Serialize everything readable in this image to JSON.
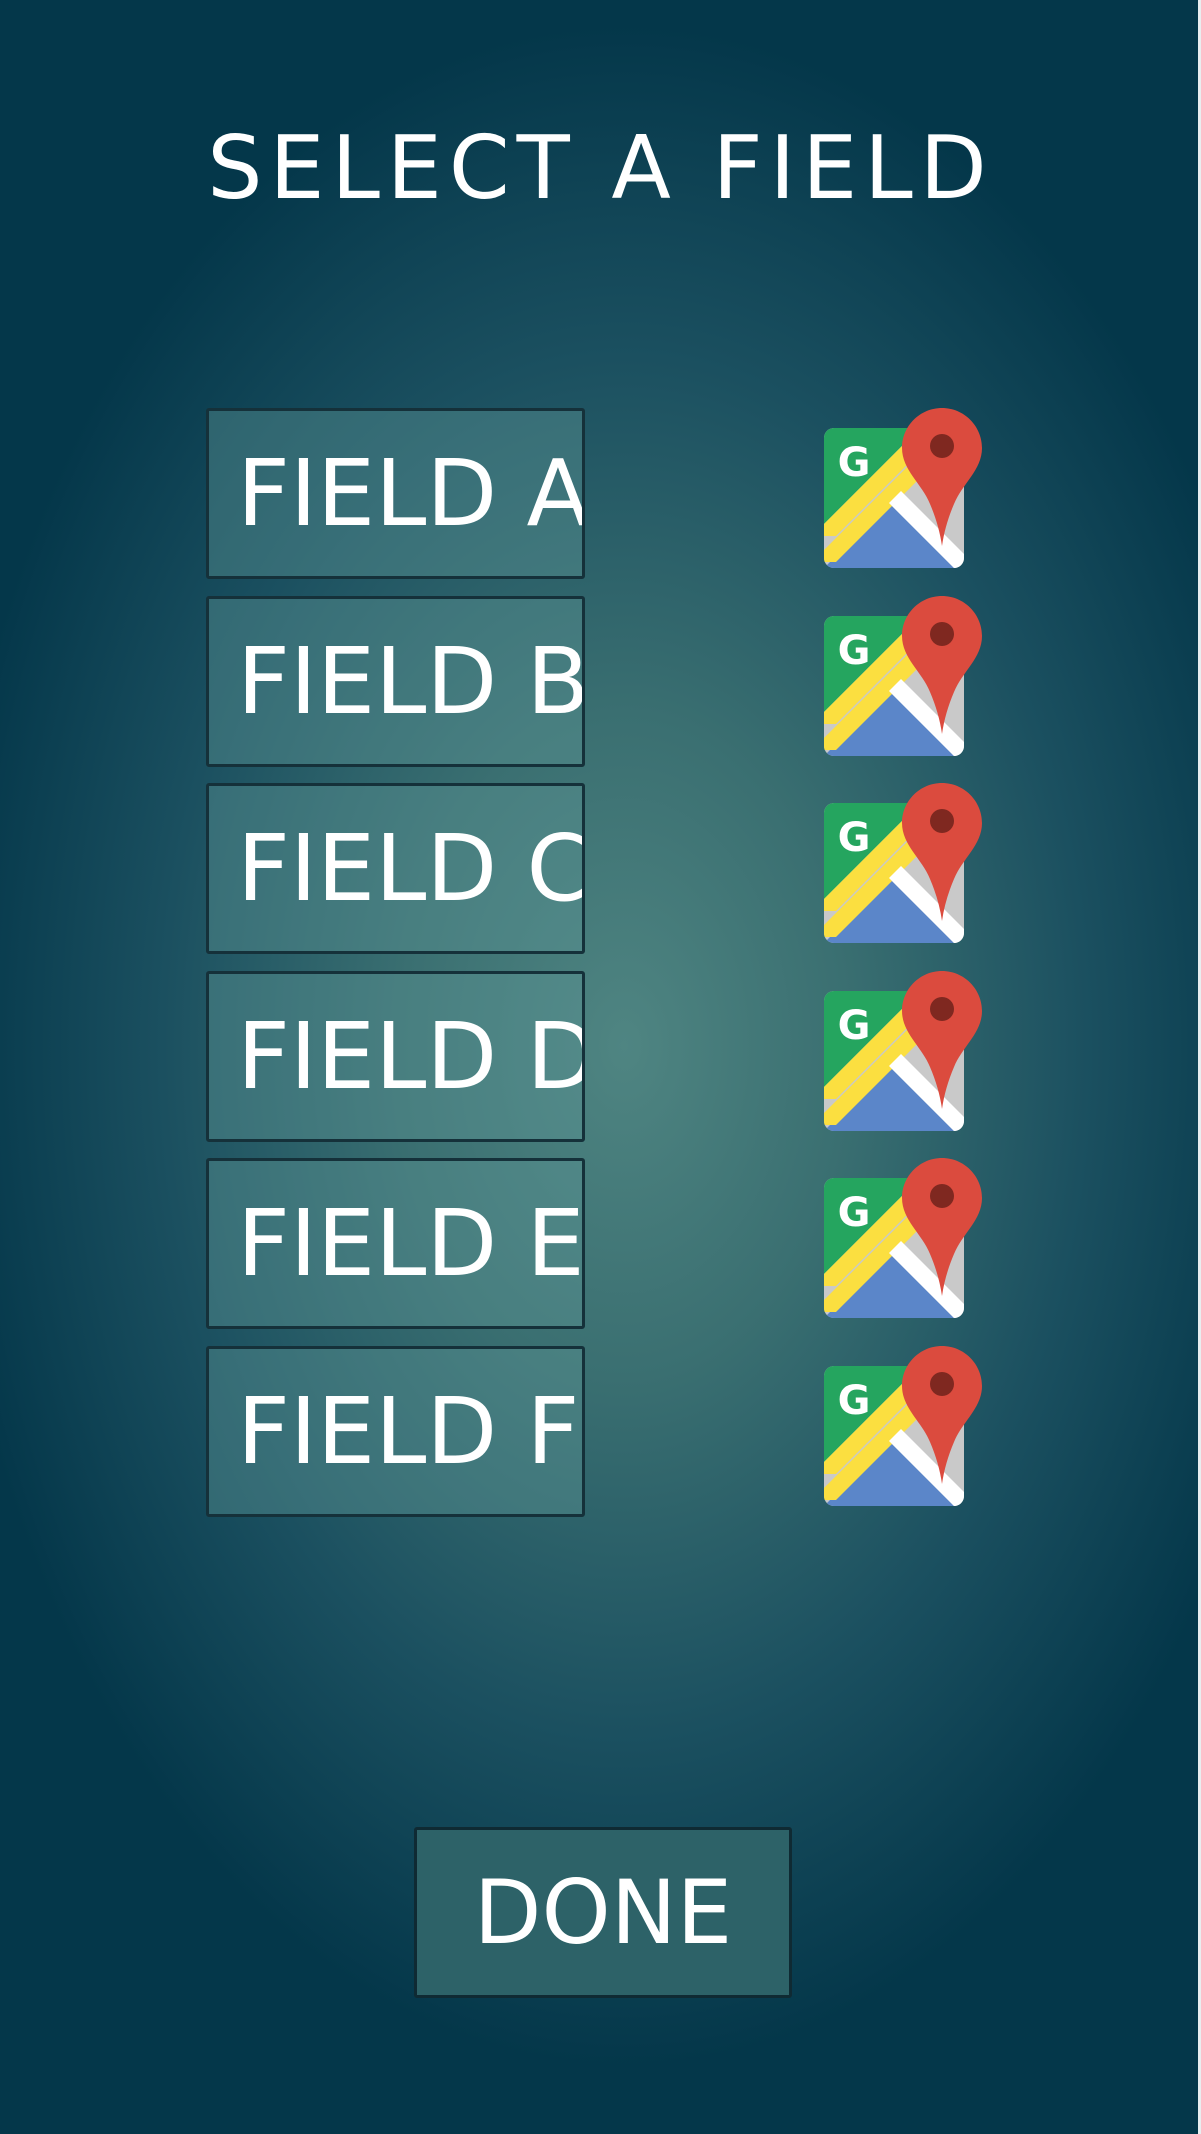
{
  "screen": {
    "title": "SELECT A FIELD"
  },
  "fields": [
    {
      "label": "FIELD A",
      "map_icon": "google-maps-icon"
    },
    {
      "label": "FIELD B",
      "map_icon": "google-maps-icon"
    },
    {
      "label": "FIELD C",
      "map_icon": "google-maps-icon"
    },
    {
      "label": "FIELD D",
      "map_icon": "google-maps-icon"
    },
    {
      "label": "FIELD E",
      "map_icon": "google-maps-icon"
    },
    {
      "label": "FIELD F",
      "map_icon": "google-maps-icon"
    }
  ],
  "actions": {
    "done_label": "DONE"
  },
  "colors": {
    "background": "#04374a",
    "button_fill": "#3f7576",
    "text": "#ffffff"
  }
}
